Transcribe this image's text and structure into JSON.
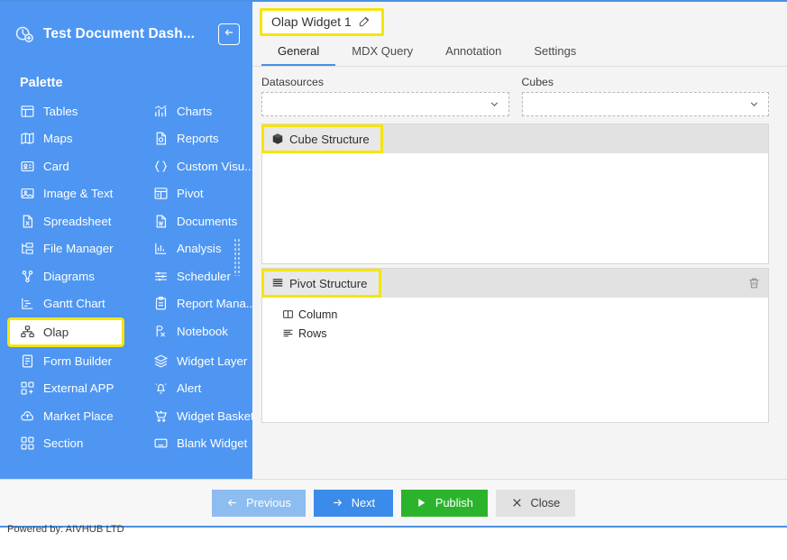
{
  "theme": {
    "sidebar_bg": "#4e96f2",
    "highlight": "#f5e50a",
    "accent": "#4a90e2",
    "publish_green": "#2cb32c"
  },
  "sidebar": {
    "title": "Test Document Dash...",
    "dashboard_icon": "dashboard-gauge-icon",
    "collapse_icon": "arrow-left-box-icon",
    "palette_heading": "Palette",
    "items": [
      {
        "label": "Tables",
        "icon": "table-icon",
        "selected": false
      },
      {
        "label": "Charts",
        "icon": "bar-chart-icon",
        "selected": false
      },
      {
        "label": "Maps",
        "icon": "map-icon",
        "selected": false
      },
      {
        "label": "Reports",
        "icon": "report-doc-icon",
        "selected": false
      },
      {
        "label": "Card",
        "icon": "id-card-icon",
        "selected": false
      },
      {
        "label": "Custom Visu...",
        "icon": "braces-icon",
        "selected": false
      },
      {
        "label": "Image & Text",
        "icon": "image-icon",
        "selected": false
      },
      {
        "label": "Pivot",
        "icon": "pivot-table-icon",
        "selected": false
      },
      {
        "label": "Spreadsheet",
        "icon": "excel-file-icon",
        "selected": false
      },
      {
        "label": "Documents",
        "icon": "word-file-icon",
        "selected": false
      },
      {
        "label": "File Manager",
        "icon": "folder-tree-icon",
        "selected": false
      },
      {
        "label": "Analysis",
        "icon": "analysis-chart-icon",
        "selected": false
      },
      {
        "label": "Diagrams",
        "icon": "node-graph-icon",
        "selected": false
      },
      {
        "label": "Scheduler",
        "icon": "sliders-icon",
        "selected": false
      },
      {
        "label": "Gantt Chart",
        "icon": "gantt-icon",
        "selected": false
      },
      {
        "label": "Report Mana...",
        "icon": "clipboard-icon",
        "selected": false
      },
      {
        "label": "Olap",
        "icon": "olap-cube-icon",
        "selected": true
      },
      {
        "label": "Notebook",
        "icon": "notebook-rx-icon",
        "selected": false
      },
      {
        "label": "Form Builder",
        "icon": "form-icon",
        "selected": false
      },
      {
        "label": "Widget Layer",
        "icon": "layers-icon",
        "selected": false
      },
      {
        "label": "External APP",
        "icon": "external-app-icon",
        "selected": false
      },
      {
        "label": "Alert",
        "icon": "bell-alert-icon",
        "selected": false
      },
      {
        "label": "Market Place",
        "icon": "cloud-market-icon",
        "selected": false
      },
      {
        "label": "Widget Basket",
        "icon": "shopping-cart-icon",
        "selected": false
      },
      {
        "label": "Section",
        "icon": "section-grid-icon",
        "selected": false
      },
      {
        "label": "Blank Widget",
        "icon": "blank-widget-icon",
        "selected": false
      }
    ],
    "resize_grip": "drag-grip-handle"
  },
  "widget": {
    "title": "Olap Widget 1",
    "edit_icon": "pencil-edit-icon",
    "tabs": [
      {
        "label": "General",
        "active": true
      },
      {
        "label": "MDX Query",
        "active": false
      },
      {
        "label": "Annotation",
        "active": false
      },
      {
        "label": "Settings",
        "active": false
      }
    ]
  },
  "fields": {
    "datasources": {
      "label": "Datasources",
      "value": "",
      "placeholder": "",
      "chevron": "chevron-down-icon"
    },
    "cubes": {
      "label": "Cubes",
      "value": "",
      "placeholder": "",
      "chevron": "chevron-down-icon"
    }
  },
  "cube_structure": {
    "label": "Cube Structure",
    "icon": "cube-3d-icon",
    "items": []
  },
  "pivot_structure": {
    "label": "Pivot Structure",
    "icon": "list-lines-icon",
    "delete_icon": "trash-icon",
    "nodes": [
      {
        "label": "Column",
        "icon": "column-layout-icon"
      },
      {
        "label": "Rows",
        "icon": "rows-layout-icon"
      }
    ]
  },
  "buttons": [
    {
      "label": "Previous",
      "icon": "arrow-left-icon",
      "style": "prev"
    },
    {
      "label": "Next",
      "icon": "arrow-right-icon",
      "style": "next"
    },
    {
      "label": "Publish",
      "icon": "play-icon",
      "style": "publish"
    },
    {
      "label": "Close",
      "icon": "x-icon",
      "style": "close"
    }
  ],
  "footer": {
    "powered_by": "Powered by: AIVHUB LTD"
  }
}
